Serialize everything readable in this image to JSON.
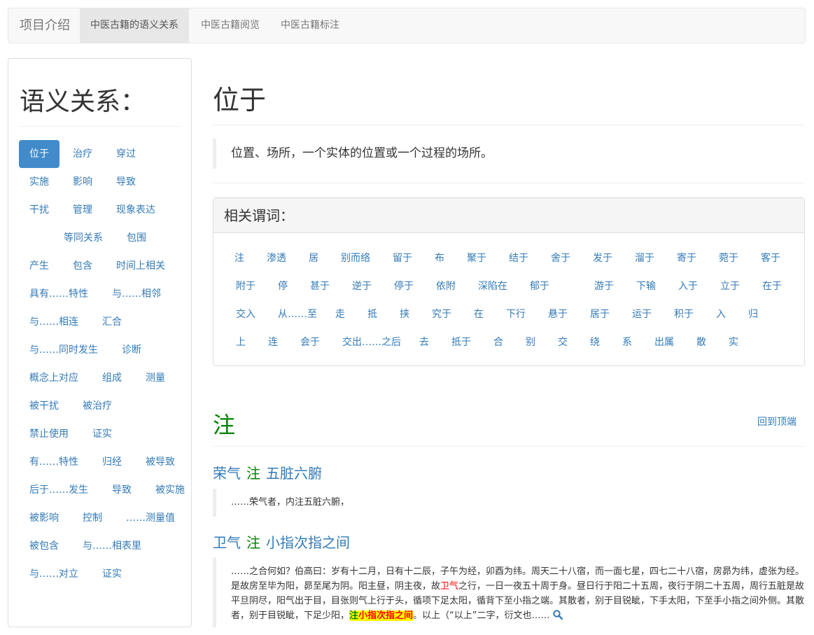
{
  "navbar": {
    "brand": "项目介绍",
    "tabs": [
      {
        "label": "中医古籍的语义关系",
        "active": true
      },
      {
        "label": "中医古籍阅览",
        "active": false
      },
      {
        "label": "中医古籍标注",
        "active": false
      }
    ]
  },
  "sidebar": {
    "title": "语义关系：",
    "items": [
      "位于",
      "治疗",
      "穿过",
      "实施",
      "影响",
      "导致",
      "干扰",
      "管理",
      "现象表达",
      "等同关系",
      "包围",
      "产生",
      "包含",
      "时间上相关",
      "具有……特性",
      "与……相邻",
      "与……相连",
      "汇合",
      "与……同时发生",
      "诊断",
      "概念上对应",
      "组成",
      "测量",
      "被干扰",
      "被治疗",
      "禁止使用",
      "证实",
      "有……特性",
      "归经",
      "被导致",
      "后于……发生",
      "导致",
      "被实施",
      "被影响",
      "控制",
      "……测量值",
      "被包含",
      "与……相表里",
      "与……对立",
      "证实"
    ]
  },
  "main": {
    "title": "位于",
    "definition": "位置、场所，一个实体的位置或一个过程的场所。",
    "related_heading": "相关谓词：",
    "related_words": [
      "注",
      "渗透",
      "居",
      "别而络",
      "留于",
      "布",
      "聚于",
      "结于",
      "舍于",
      "发于",
      "溜于",
      "寄于",
      "菀于",
      "客于",
      "附于",
      "停",
      "甚于",
      "逆于",
      "停于",
      "依附",
      "深陷在",
      "郁于",
      "游于",
      "下输",
      "入于",
      "立于",
      "在于",
      "交入",
      "从……至",
      "走",
      "抵",
      "挟",
      "究于",
      "在",
      "下行",
      "悬于",
      "居于",
      "运于",
      "积于",
      "入",
      "归",
      "上",
      "连",
      "会于",
      "交出……之后",
      "去",
      "抵于",
      "合",
      "别",
      "交",
      "绕",
      "系",
      "出属",
      "散",
      "实"
    ],
    "section_title": "注",
    "back_to_top": "回到顶端",
    "relations": [
      {
        "head": "荣气",
        "rel": "注",
        "tail": "五脏六腑",
        "quote": "……荣气者，内注五脏六腑，"
      },
      {
        "head": "卫气",
        "rel": "注",
        "tail": "小指次指之间",
        "quote_parts": {
          "p1": "……之合何如？伯高曰：岁有十二月，日有十二辰，子午为经，卯酉为纬。周天二十八宿，而一面七星，四七二十八宿，房昴为纬，虚张为经。是故房至毕为阳，昴至尾为阴。阳主昼，阴主夜，故",
          "hl1": "卫气",
          "p2": "之行，一日一夜五十周于身。昼日行于阳二十五周，夜行于阴二十五周，周行五脏是故平旦阴尽，阳气出于目，目张则气上行于头，循项下足太阳，循背下至小指之端。其散者，别于目锐眦，下手太阳，下至手小指之间外侧。其散者，别于目锐眦，下足少阳，",
          "hl2a": "注",
          "hl2b": "小指次指之间",
          "p3": "。以上（“以上”二字，衍文也……"
        }
      }
    ]
  },
  "icons": {
    "search": "magnifier-icon"
  },
  "colors": {
    "accent": "#337ab7",
    "active_pill": "#428bca",
    "relation": "#008000",
    "highlight": "#ffff00",
    "highlight_text": "#ff0000"
  }
}
